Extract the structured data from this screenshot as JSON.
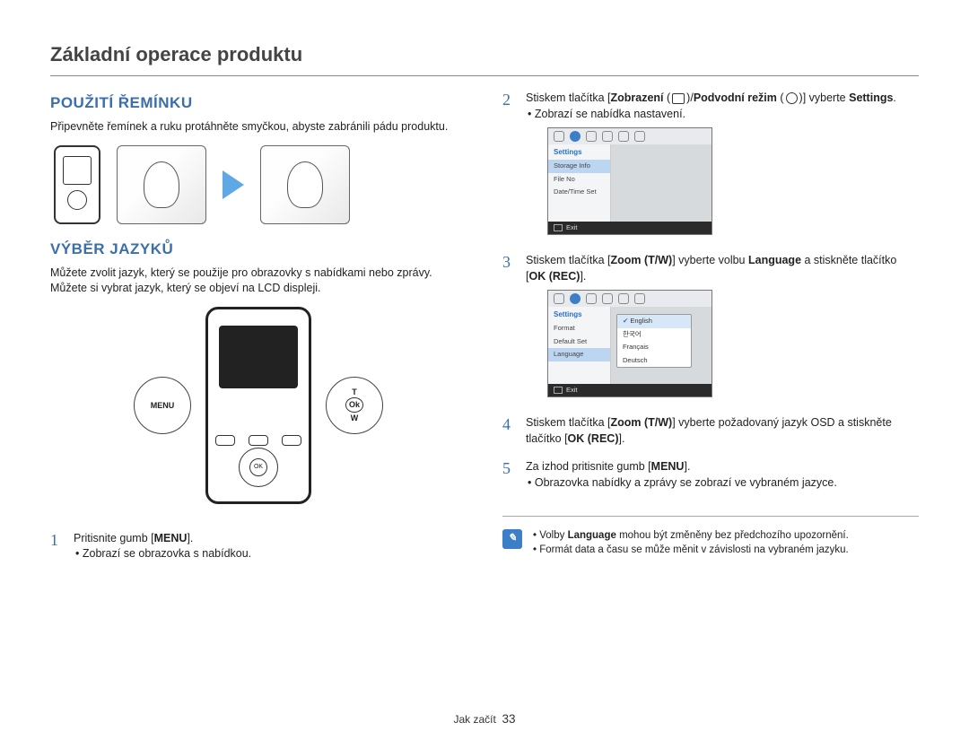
{
  "page_title": "Základní operace produktu",
  "left": {
    "strap_heading": "POUŽITÍ ŘEMÍNKU",
    "strap_text": "Připevněte řemínek a ruku protáhněte smyčkou, abyste zabránili pádu produktu.",
    "lang_heading": "VÝBĚR JAZYKŮ",
    "lang_text": "Můžete zvolit jazyk, který se použije pro obrazovky s nabídkami nebo zprávy. Můžete si vybrat jazyk, který se objeví na LCD displeji.",
    "menu_label": "MENU",
    "dpad_t": "T",
    "dpad_ok": "Ok",
    "dpad_w": "W",
    "step1_num": "1",
    "step1_text_a": "Pritisnite gumb [",
    "step1_text_b": "MENU",
    "step1_text_c": "].",
    "step1_bullet": "Zobrazí se obrazovka s nabídkou."
  },
  "right": {
    "step2_num": "2",
    "step2_a": "Stiskem tlačítka [",
    "step2_b": "Zobrazení",
    "step2_c": " (",
    "step2_d": ")/",
    "step2_e": "Podvodní režim",
    "step2_f": " (",
    "step2_g": ")] vyberte ",
    "step2_h": "Settings",
    "step2_i": ".",
    "step2_bullet": "Zobrazí se nabídka nastavení.",
    "ss1": {
      "hdr": "Settings",
      "r1": "Storage Info",
      "r2": "File No",
      "r3": "Date/Time Set",
      "exit": "Exit"
    },
    "step3_num": "3",
    "step3_a": "Stiskem tlačítka [",
    "step3_b": "Zoom (T/W)",
    "step3_c": "] vyberte volbu ",
    "step3_d": "Language",
    "step3_e": " a stiskněte tlačítko [",
    "step3_f": "OK (REC)",
    "step3_g": "].",
    "ss2": {
      "hdr": "Settings",
      "r1": "Format",
      "r2": "Default Set",
      "r3": "Language",
      "p1": "English",
      "p2": "한국어",
      "p3": "Français",
      "p4": "Deutsch",
      "exit": "Exit"
    },
    "step4_num": "4",
    "step4_a": "Stiskem tlačítka [",
    "step4_b": "Zoom (T/W)",
    "step4_c": "] vyberte požadovaný jazyk OSD a stiskněte tlačítko [",
    "step4_d": "OK (REC)",
    "step4_e": "].",
    "step5_num": "5",
    "step5_a": "Za izhod pritisnite gumb [",
    "step5_b": "MENU",
    "step5_c": "].",
    "step5_bullet": "Obrazovka nabídky a zprávy se zobrazí ve vybraném jazyce.",
    "notes": {
      "n1_a": "Volby ",
      "n1_b": "Language",
      "n1_c": " mohou být změněny bez předchozího upozornění.",
      "n2": "Formát data a času se může měnit v závislosti na vybraném jazyku."
    }
  },
  "footer": {
    "section": "Jak začít",
    "page": "33"
  }
}
